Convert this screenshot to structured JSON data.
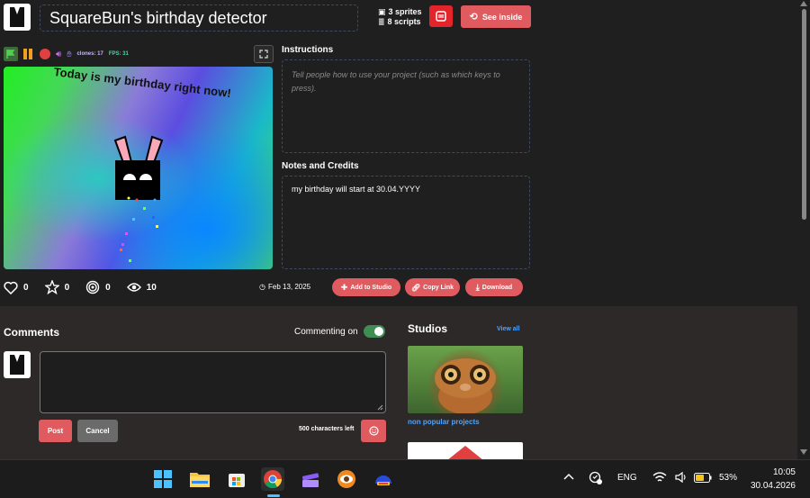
{
  "project": {
    "title": "SquareBun's birthday detector",
    "sprites": "3 sprites",
    "scripts": "8 scripts",
    "see_inside": "See inside"
  },
  "player": {
    "clones": "clones: 17",
    "fps": "FPS: 31",
    "stage_text": "Today is my birthday right now!"
  },
  "instructions": {
    "heading": "Instructions",
    "placeholder": "Tell people how to use your project (such as which keys to press)."
  },
  "notes": {
    "heading": "Notes and Credits",
    "text": "my birthday will start at 30.04.YYYY"
  },
  "engagement": {
    "loves": "0",
    "favorites": "0",
    "remixes": "0",
    "views": "10",
    "date": "Feb 13, 2025"
  },
  "actions": {
    "add_to_studio": "Add to Studio",
    "copy_link": "Copy Link",
    "download": "Download"
  },
  "comments": {
    "title": "Comments",
    "commenting_on": "Commenting on",
    "post": "Post",
    "cancel": "Cancel",
    "chars_left": "500 characters left"
  },
  "studios": {
    "title": "Studios",
    "view_all": "View all",
    "items": [
      {
        "name": "non popular projects"
      }
    ]
  },
  "taskbar": {
    "language": "ENG",
    "battery": "53%",
    "time": "10:05",
    "date": "30.04.2026"
  },
  "colors": {
    "accent": "#e05b60",
    "link": "#4aa3ff",
    "toggle_on": "#3f8d53"
  }
}
